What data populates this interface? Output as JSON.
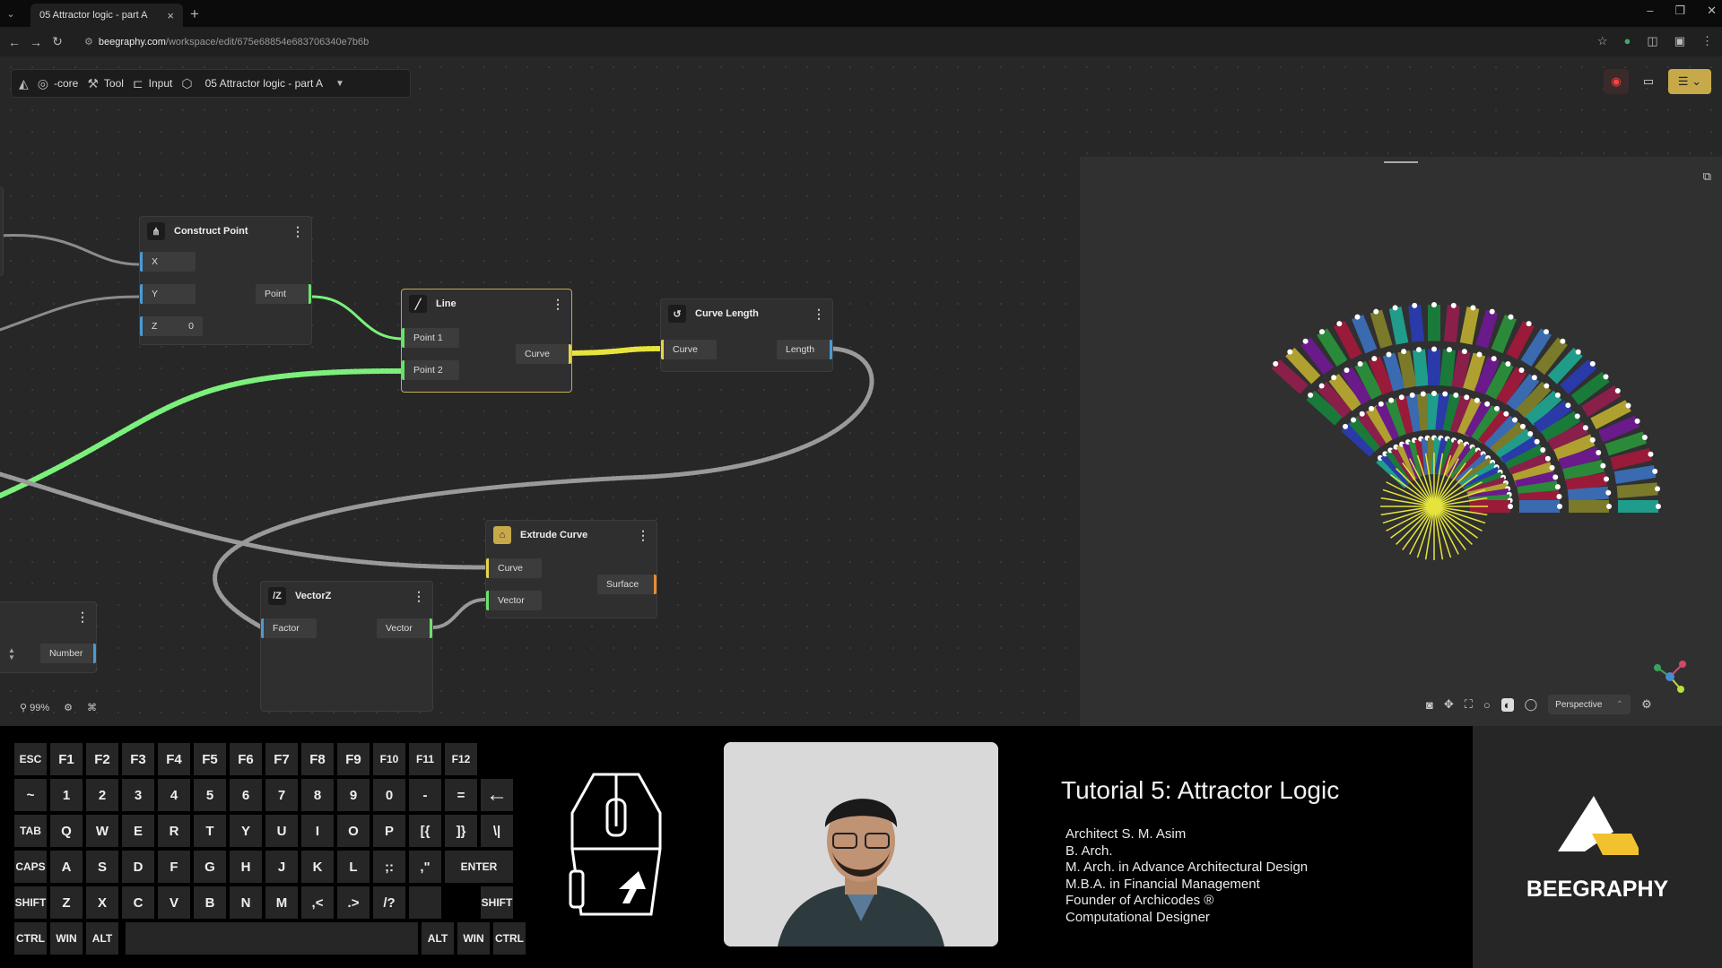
{
  "browser": {
    "tab_title": "05 Attractor logic - part A",
    "tab_close": "×",
    "new_tab": "+",
    "url_domain": "beegraphy.com",
    "url_path": "/workspace/edit/675e68854e683706340e7b6b"
  },
  "toolbar": {
    "core_label": "-core",
    "tool_label": "Tool",
    "input_label": "Input",
    "project_label": "05 Attractor logic - part A"
  },
  "nodes": {
    "construct_point": {
      "title": "Construct Point",
      "in_x": "X",
      "in_y": "Y",
      "in_z": "Z",
      "z_value": "0",
      "out": "Point"
    },
    "line": {
      "title": "Line",
      "in1": "Point 1",
      "in2": "Point 2",
      "out": "Curve"
    },
    "curve_length": {
      "title": "Curve Length",
      "in": "Curve",
      "out": "Length"
    },
    "extrude_curve": {
      "title": "Extrude Curve",
      "in1": "Curve",
      "in2": "Vector",
      "out": "Surface"
    },
    "vectorz": {
      "title": "VectorZ",
      "in": "Factor",
      "out": "Vector"
    },
    "number": {
      "out": "Number"
    }
  },
  "canvas": {
    "zoom": "99%"
  },
  "viewport": {
    "mode": "Perspective"
  },
  "keyboard": {
    "row1": [
      "ESC",
      "F1",
      "F2",
      "F3",
      "F4",
      "F5",
      "F6",
      "F7",
      "F8",
      "F9",
      "F10",
      "F11",
      "F12"
    ],
    "row2": [
      "~",
      "1",
      "2",
      "3",
      "4",
      "5",
      "6",
      "7",
      "8",
      "9",
      "0",
      "-",
      "=",
      "←"
    ],
    "row3": [
      "TAB",
      "Q",
      "W",
      "E",
      "R",
      "T",
      "Y",
      "U",
      "I",
      "O",
      "P",
      "[{",
      "]}",
      "\\|"
    ],
    "row4": [
      "CAPS",
      "A",
      "S",
      "D",
      "F",
      "G",
      "H",
      "J",
      "K",
      "L",
      ";:",
      ",\"",
      "ENTER"
    ],
    "row5": [
      "SHIFT",
      "Z",
      "X",
      "C",
      "V",
      "B",
      "N",
      "M",
      ",<",
      ".>",
      "/?",
      "SHIFT"
    ],
    "row6": [
      "CTRL",
      "WIN",
      "ALT",
      "ALT",
      "WIN",
      "CTRL"
    ]
  },
  "tutorial": {
    "title": "Tutorial 5: Attractor Logic",
    "lines": [
      "Architect S. M. Asim",
      "B. Arch.",
      "M. Arch. in Advance Architectural Design",
      "M.B.A. in Financial Management",
      "Founder of Archicodes ®",
      "Computational Designer"
    ]
  },
  "brand": {
    "name": "BEEGRAPHY"
  },
  "colors": {
    "wire_green": "#7cf07c",
    "wire_yellow": "#e6e43c",
    "wire_gray": "#9a9a9a",
    "accent_gold": "#c7a94a"
  }
}
